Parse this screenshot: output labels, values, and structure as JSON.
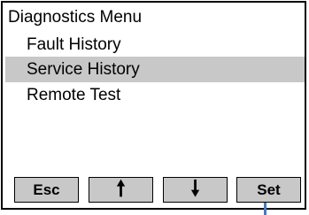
{
  "menu": {
    "title": "Diagnostics Menu",
    "items": [
      {
        "label": "Fault History",
        "selected": false
      },
      {
        "label": "Service History",
        "selected": true
      },
      {
        "label": "Remote Test",
        "selected": false
      }
    ]
  },
  "softkeys": {
    "esc_label": "Esc",
    "up_icon": "arrow-up-icon",
    "up_glyph": "🠕",
    "down_icon": "arrow-down-icon",
    "down_glyph": "🠗",
    "set_label": "Set"
  },
  "colors": {
    "selection": "#c8c8c8",
    "indicator": "#4a7ab5"
  }
}
